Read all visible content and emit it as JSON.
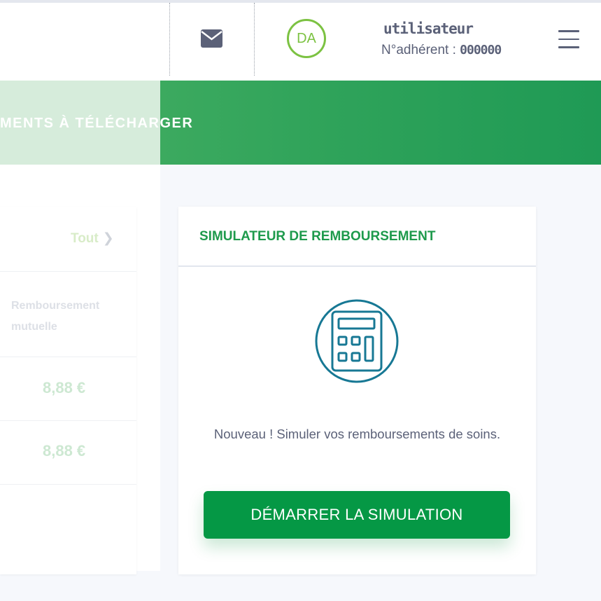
{
  "header": {
    "icons": {
      "mail": "envelope-icon",
      "menu": "hamburger-menu-icon"
    },
    "avatar_initials": "DA",
    "user_name": "utilisateur",
    "member_label": "N°adhérent : ",
    "member_number": "000000"
  },
  "banner": {
    "text": "MENTS À TÉLÉCHARGER"
  },
  "left_card": {
    "see_all_label": "Tout",
    "column_header": "Remboursement mutuelle",
    "rows": [
      {
        "amount": "8,88 €"
      },
      {
        "amount": "8,88 €"
      }
    ]
  },
  "simulator": {
    "title": "SIMULATEUR DE REMBOURSEMENT",
    "icon": "calculator-icon",
    "description": "Nouveau ! Simuler vos remboursements de soins.",
    "button_label": "DÉMARRER LA SIMULATION"
  },
  "colors": {
    "primary_green": "#059845",
    "title_green": "#1e9a4c",
    "avatar_green": "#7cc242",
    "icon_teal": "#177894",
    "text_gray": "#5b6178"
  }
}
